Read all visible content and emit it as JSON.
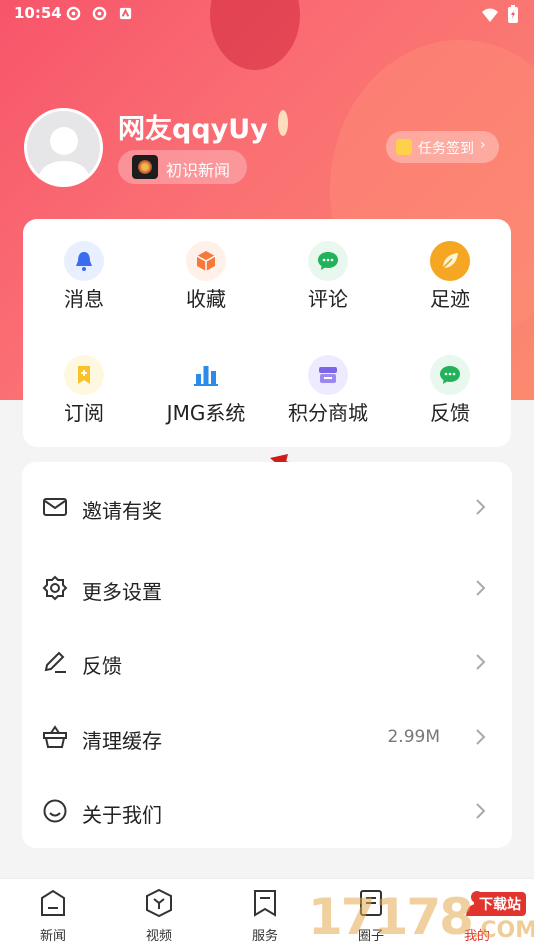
{
  "status_bar": {
    "time": "10:54"
  },
  "profile": {
    "username": "网友qqyUy",
    "level_label": "初识新闻",
    "checkin_label": "任务签到",
    "checkin_arrow": "›"
  },
  "grid": [
    {
      "label": "消息",
      "icon": "bell-icon",
      "bg": "#e8efff",
      "color": "#3a6cf0"
    },
    {
      "label": "收藏",
      "icon": "box-icon",
      "bg": "#fff0ea",
      "color": "#f5793b"
    },
    {
      "label": "评论",
      "icon": "chat-icon",
      "bg": "#e8f8ee",
      "color": "#22b35a"
    },
    {
      "label": "足迹",
      "icon": "leaf-icon",
      "bg": "#fff5e0",
      "color": "#f5a623"
    },
    {
      "label": "订阅",
      "icon": "bookmark-icon",
      "bg": "#fff8e0",
      "color": "#f7c22a"
    },
    {
      "label": "JMG系统",
      "icon": "bar-chart-icon",
      "bg": "#ffffff",
      "color": "#2a8be8"
    },
    {
      "label": "积分商城",
      "icon": "store-icon",
      "bg": "#eeeaff",
      "color": "#7a64e8"
    },
    {
      "label": "反馈",
      "icon": "chat-icon",
      "bg": "#e8f8ee",
      "color": "#22b35a"
    }
  ],
  "list": [
    {
      "label": "邀请有奖",
      "icon": "mail-icon",
      "value": ""
    },
    {
      "label": "更多设置",
      "icon": "gear-icon",
      "value": ""
    },
    {
      "label": "反馈",
      "icon": "pen-icon",
      "value": ""
    },
    {
      "label": "清理缓存",
      "icon": "basket-icon",
      "value": "2.99M"
    },
    {
      "label": "关于我们",
      "icon": "smile-icon",
      "value": ""
    }
  ],
  "tabbar": [
    {
      "label": "新闻",
      "icon": "news-icon"
    },
    {
      "label": "视频",
      "icon": "video-icon"
    },
    {
      "label": "服务",
      "icon": "service-icon"
    },
    {
      "label": "圈子",
      "icon": "circle-icon"
    },
    {
      "label": "我的",
      "icon": "profile-icon"
    }
  ],
  "watermark": {
    "number": "17178",
    "site": "下载站",
    "domain": ".COM"
  },
  "colors": {
    "accent": "#f7556a",
    "active_tab": "#e2332d"
  }
}
